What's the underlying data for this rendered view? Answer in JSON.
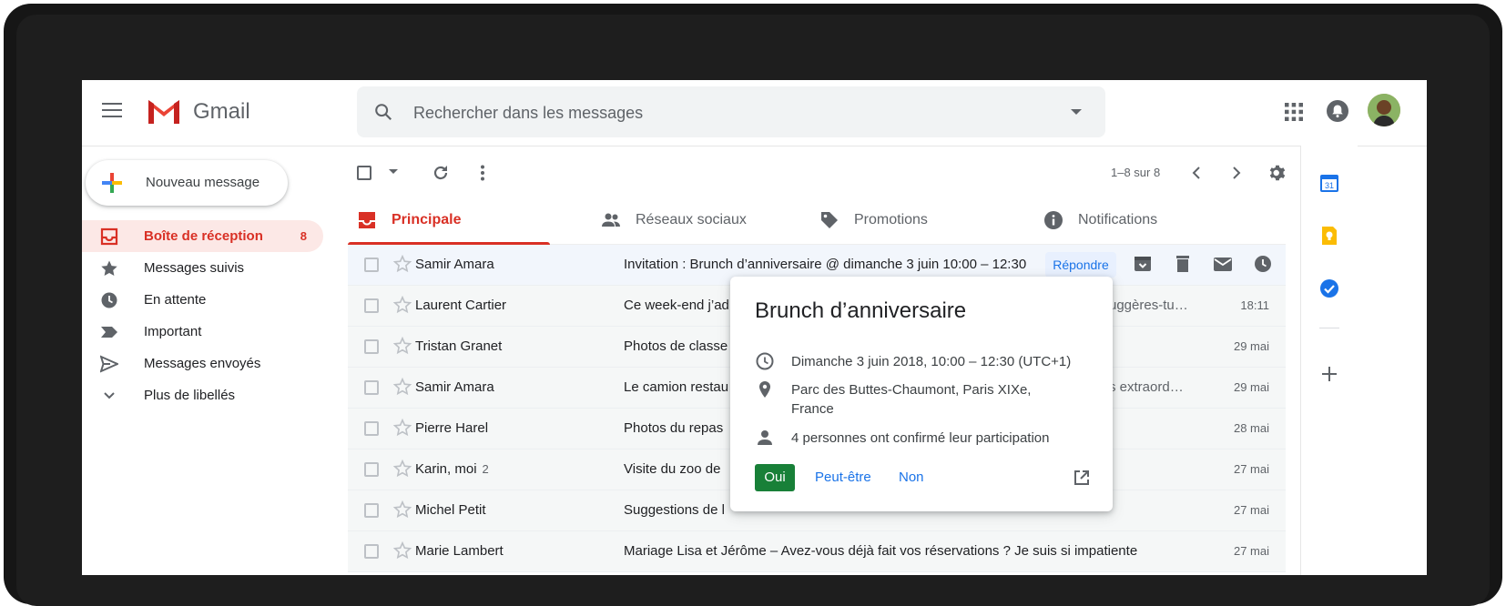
{
  "app": {
    "name": "Gmail"
  },
  "search": {
    "placeholder": "Rechercher dans les messages"
  },
  "compose": {
    "label": "Nouveau message"
  },
  "nav": [
    {
      "label": "Boîte de réception",
      "count": "8",
      "icon": "inbox-icon",
      "active": true
    },
    {
      "label": "Messages suivis",
      "icon": "star-icon"
    },
    {
      "label": "En attente",
      "icon": "clock-icon"
    },
    {
      "label": "Important",
      "icon": "important-icon"
    },
    {
      "label": "Messages envoyés",
      "icon": "send-icon"
    },
    {
      "label": "Plus de libellés",
      "icon": "chevron-down-icon"
    }
  ],
  "toolbar": {
    "pager": "1–8 sur 8"
  },
  "tabs": [
    {
      "label": "Principale",
      "icon": "inbox-icon",
      "active": true
    },
    {
      "label": "Réseaux sociaux",
      "icon": "people-icon"
    },
    {
      "label": "Promotions",
      "icon": "tag-icon"
    },
    {
      "label": "Notifications",
      "icon": "info-icon"
    }
  ],
  "emails": [
    {
      "sender": "Samir Amara",
      "thread": "",
      "subject": "Invitation : Brunch d’anniversaire @ dimanche 3 juin 10:00 – 12:30",
      "snippet_right": "",
      "date": ""
    },
    {
      "sender": "Laurent Cartier",
      "thread": "",
      "subject": "Ce week-end j’ad",
      "snippet_right": "uggères-tu…",
      "date": "18:11"
    },
    {
      "sender": "Tristan Granet",
      "thread": "",
      "subject": "Photos de classe",
      "snippet_right": "",
      "date": "29 mai"
    },
    {
      "sender": "Samir Amara",
      "thread": "",
      "subject": "Le camion restau",
      "snippet_right": "s extraord…",
      "date": "29 mai"
    },
    {
      "sender": "Pierre Harel",
      "thread": "",
      "subject": "Photos du repas",
      "snippet_right": "",
      "date": "28 mai"
    },
    {
      "sender": "Karin, moi",
      "thread": "2",
      "subject": "Visite du zoo de",
      "snippet_right": "",
      "date": "27 mai"
    },
    {
      "sender": "Michel Petit",
      "thread": "",
      "subject": "Suggestions de l",
      "snippet_right": "",
      "date": "27 mai"
    },
    {
      "sender": "Marie Lambert",
      "thread": "",
      "subject": "Mariage Lisa et Jérôme – Avez-vous déjà fait vos réservations ? Je suis si impatiente",
      "snippet_right": "",
      "date": "27 mai"
    }
  ],
  "hover": {
    "reply_label": "Répondre"
  },
  "event_card": {
    "title": "Brunch d’anniversaire",
    "datetime": "Dimanche 3 juin 2018, 10:00 – 12:30 (UTC+1)",
    "location_line1": "Parc des Buttes-Chaumont, Paris XIXe,",
    "location_line2": "France",
    "guests": "4 personnes ont confirmé leur participation",
    "rsvp_yes": "Oui",
    "rsvp_maybe": "Peut-être",
    "rsvp_no": "Non"
  },
  "side_panel": {
    "calendar_day": "31"
  },
  "colors": {
    "accent_red": "#d93025",
    "link_blue": "#1a73e8",
    "rsvp_green": "#188038"
  }
}
